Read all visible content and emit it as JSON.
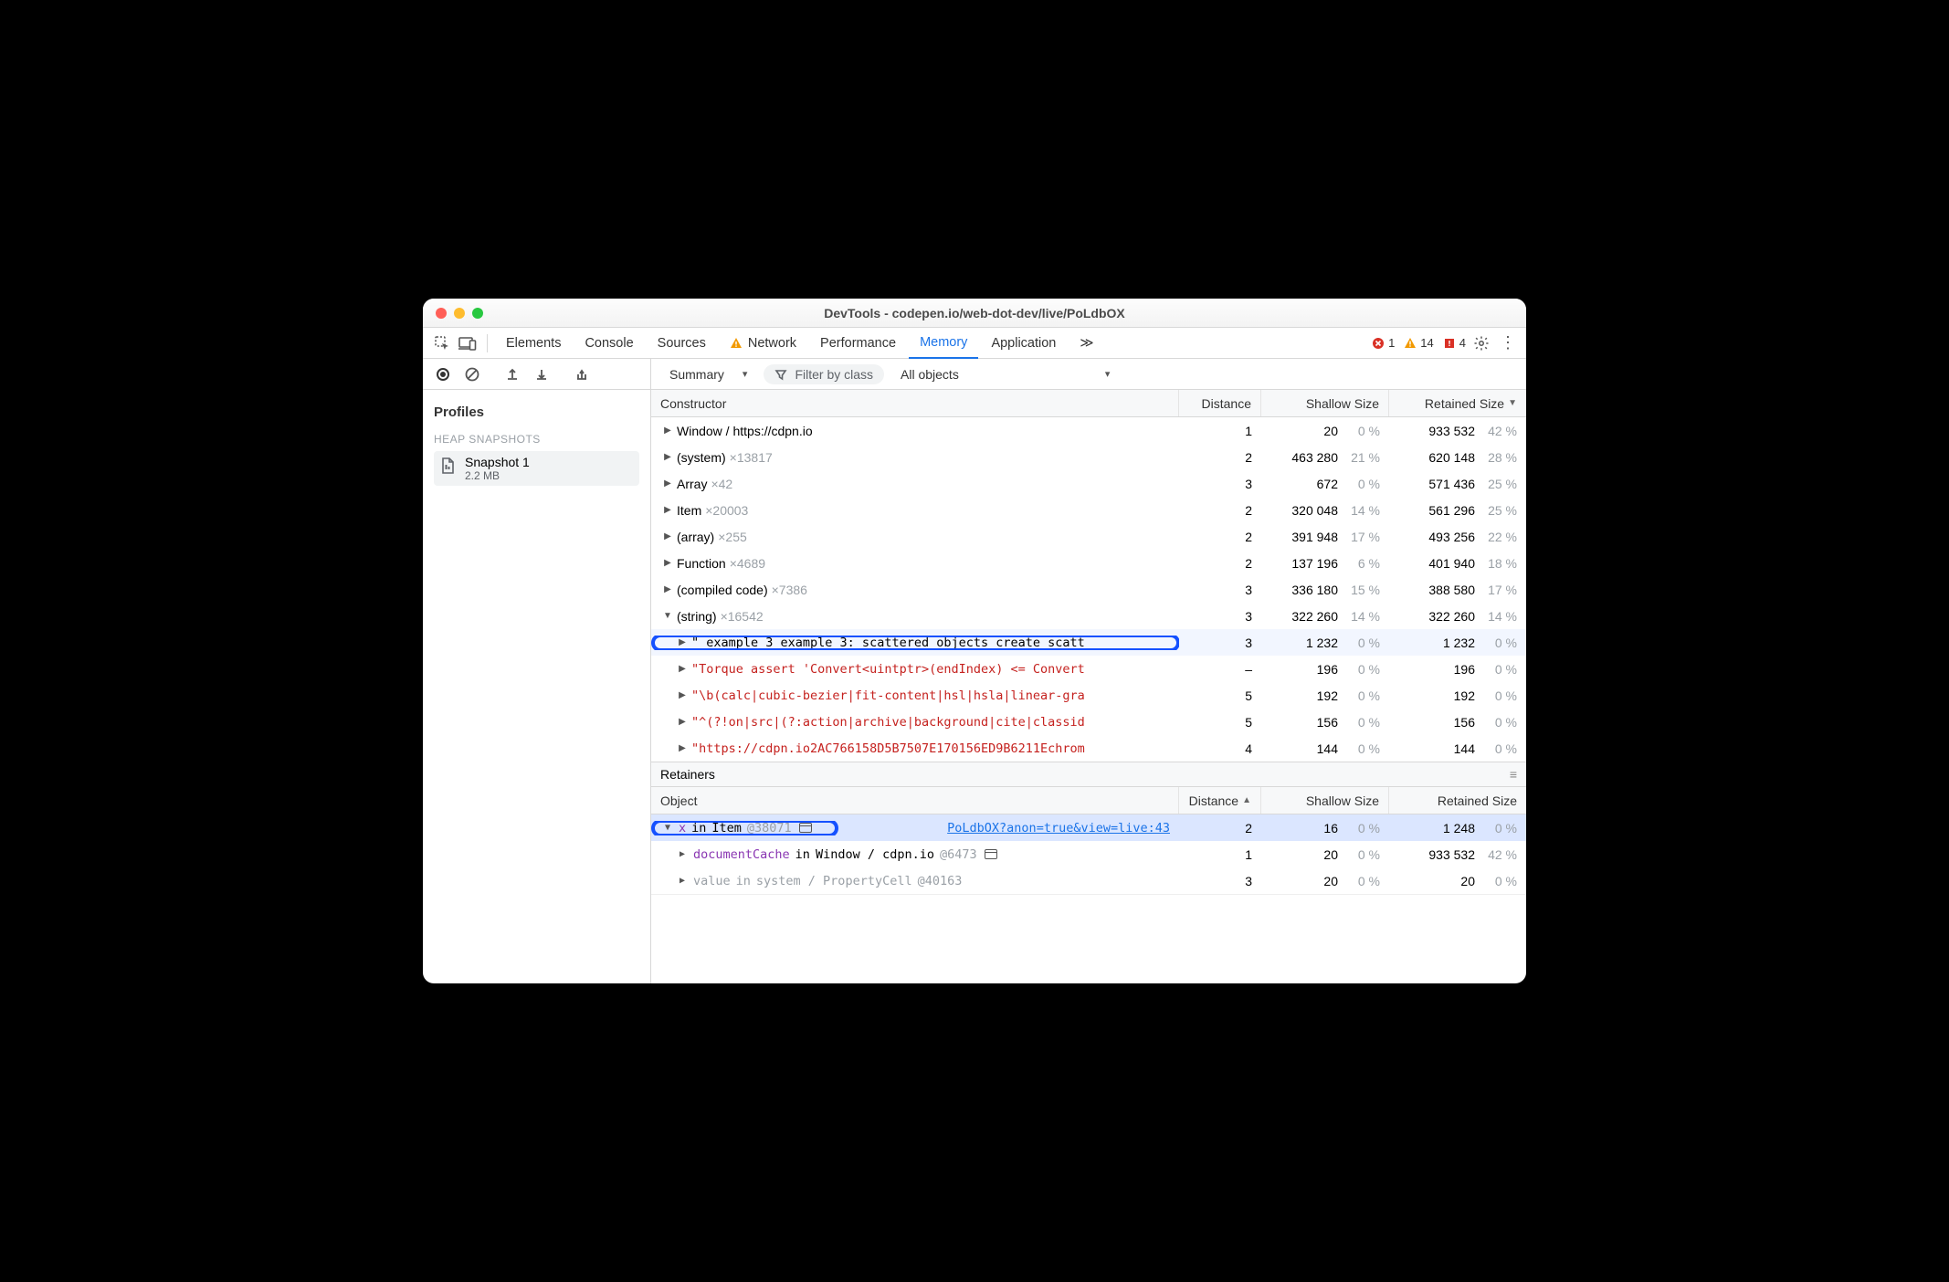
{
  "title": "DevTools - codepen.io/web-dot-dev/live/PoLdbOX",
  "tabs": {
    "elements": "Elements",
    "console": "Console",
    "sources": "Sources",
    "network": "Network",
    "performance": "Performance",
    "memory": "Memory",
    "application": "Application",
    "more": "≫"
  },
  "errors": {
    "error_count": "1",
    "warn_count": "14",
    "issue_count": "4"
  },
  "toolbar": {
    "view": "Summary",
    "filter_placeholder": "Filter by class",
    "scope": "All objects"
  },
  "sidebar": {
    "profiles_label": "Profiles",
    "section": "HEAP SNAPSHOTS",
    "snapshot_name": "Snapshot 1",
    "snapshot_size": "2.2 MB"
  },
  "grid": {
    "h_constructor": "Constructor",
    "h_distance": "Distance",
    "h_shallow": "Shallow Size",
    "h_retained": "Retained Size"
  },
  "rows": [
    {
      "label": "Window / https://cdpn.io",
      "count": "",
      "dist": "1",
      "sh": "20",
      "shp": "0 %",
      "re": "933 532",
      "rep": "42 %",
      "red": false
    },
    {
      "label": "(system)",
      "count": "×13817",
      "dist": "2",
      "sh": "463 280",
      "shp": "21 %",
      "re": "620 148",
      "rep": "28 %",
      "red": false
    },
    {
      "label": "Array",
      "count": "×42",
      "dist": "3",
      "sh": "672",
      "shp": "0 %",
      "re": "571 436",
      "rep": "25 %",
      "red": false
    },
    {
      "label": "Item",
      "count": "×20003",
      "dist": "2",
      "sh": "320 048",
      "shp": "14 %",
      "re": "561 296",
      "rep": "25 %",
      "red": false
    },
    {
      "label": "(array)",
      "count": "×255",
      "dist": "2",
      "sh": "391 948",
      "shp": "17 %",
      "re": "493 256",
      "rep": "22 %",
      "red": false
    },
    {
      "label": "Function",
      "count": "×4689",
      "dist": "2",
      "sh": "137 196",
      "shp": "6 %",
      "re": "401 940",
      "rep": "18 %",
      "red": false
    },
    {
      "label": "(compiled code)",
      "count": "×7386",
      "dist": "3",
      "sh": "336 180",
      "shp": "15 %",
      "re": "388 580",
      "rep": "17 %",
      "red": false
    }
  ],
  "string_row": {
    "label": "(string)",
    "count": "×16542",
    "dist": "3",
    "sh": "322 260",
    "shp": "14 %",
    "re": "322 260",
    "rep": "14 %"
  },
  "child_rows": [
    {
      "text": "\" example 3 example 3: scattered objects create scatt",
      "dist": "3",
      "sh": "1 232",
      "shp": "0 %",
      "re": "1 232",
      "rep": "0 %",
      "hl": true
    },
    {
      "text": "\"Torque assert 'Convert<uintptr>(endIndex) <= Convert",
      "dist": "–",
      "sh": "196",
      "shp": "0 %",
      "re": "196",
      "rep": "0 %"
    },
    {
      "text": "\"\\b(calc|cubic-bezier|fit-content|hsl|hsla|linear-gra",
      "dist": "5",
      "sh": "192",
      "shp": "0 %",
      "re": "192",
      "rep": "0 %"
    },
    {
      "text": "\"^(?!on|src|(?:action|archive|background|cite|classid",
      "dist": "5",
      "sh": "156",
      "shp": "0 %",
      "re": "156",
      "rep": "0 %"
    },
    {
      "text": "\"https://cdpn.io2AC766158D5B7507E170156ED9B6211Echrom",
      "dist": "4",
      "sh": "144",
      "shp": "0 %",
      "re": "144",
      "rep": "0 %"
    }
  ],
  "retainers": {
    "title": "Retainers",
    "h_object": "Object",
    "h_distance": "Distance",
    "h_shallow": "Shallow Size",
    "h_retained": "Retained Size",
    "rows": [
      {
        "prop": "x",
        "in": "in",
        "owner": "Item",
        "id": "@38071",
        "link": "PoLdbOX?anon=true&view=live:43",
        "dist": "2",
        "sh": "16",
        "shp": "0 %",
        "re": "1 248",
        "rep": "0 %",
        "sel": true,
        "open": true,
        "hl": true,
        "ind": 1
      },
      {
        "prop": "documentCache",
        "in": "in",
        "owner": "Window / cdpn.io",
        "id": "@6473",
        "link": "",
        "dist": "1",
        "sh": "20",
        "shp": "0 %",
        "re": "933 532",
        "rep": "42 %",
        "ind": 2
      },
      {
        "prop": "value",
        "in": "in",
        "owner": "system / PropertyCell",
        "id": "@40163",
        "link": "",
        "dist": "3",
        "sh": "20",
        "shp": "0 %",
        "re": "20",
        "rep": "0 %",
        "dim": true,
        "ind": 2
      }
    ]
  }
}
